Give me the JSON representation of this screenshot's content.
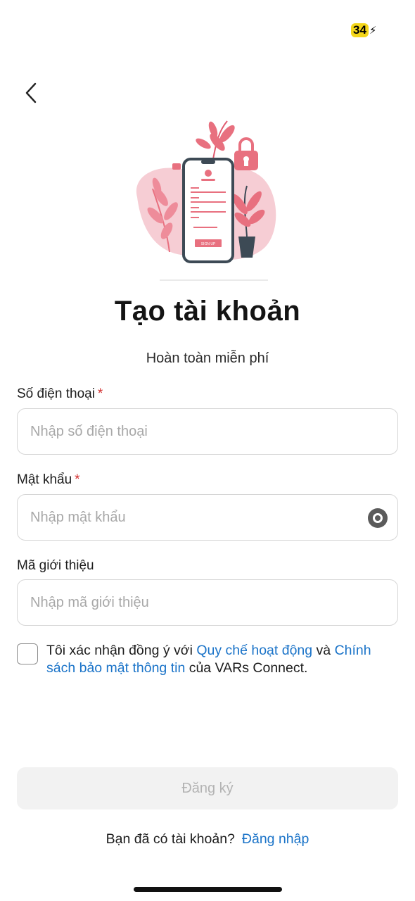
{
  "status": {
    "battery_level": "34",
    "battery_icon": "charging-bolt-icon"
  },
  "nav": {
    "back_icon": "chevron-left-icon"
  },
  "hero": {
    "illustration": "phone-registration-illustration",
    "button_caption": "SIGN UP",
    "colors": {
      "pink": "#f0b7c1",
      "accent": "#e8707f",
      "dark": "#3d4a55"
    }
  },
  "page": {
    "title": "Tạo tài khoản",
    "subtitle": "Hoàn toàn miễn phí"
  },
  "form": {
    "phone": {
      "label": "Số điện thoại",
      "required_mark": "*",
      "placeholder": "Nhập số điện thoại",
      "value": ""
    },
    "password": {
      "label": "Mật khẩu",
      "required_mark": "*",
      "placeholder": "Nhập mật khẩu",
      "value": "",
      "toggle_icon": "eye-icon"
    },
    "referral": {
      "label": "Mã giới thiệu",
      "placeholder": "Nhập mã giới thiệu",
      "value": ""
    },
    "agreement": {
      "checked": false,
      "prefix": "Tôi xác nhận đồng ý với ",
      "link1": "Quy chế hoạt động",
      "middle": " và ",
      "link2": "Chính sách bảo mật thông tin",
      "suffix": " của VARs Connect."
    },
    "submit_label": "Đăng ký"
  },
  "footer": {
    "question": "Bạn đã có tài khoản?",
    "login_link": "Đăng nhập"
  },
  "colors": {
    "link": "#1a73c8",
    "required": "#d32f2f",
    "disabled_button_bg": "#f2f2f2",
    "disabled_button_text": "#b3b3b3"
  }
}
